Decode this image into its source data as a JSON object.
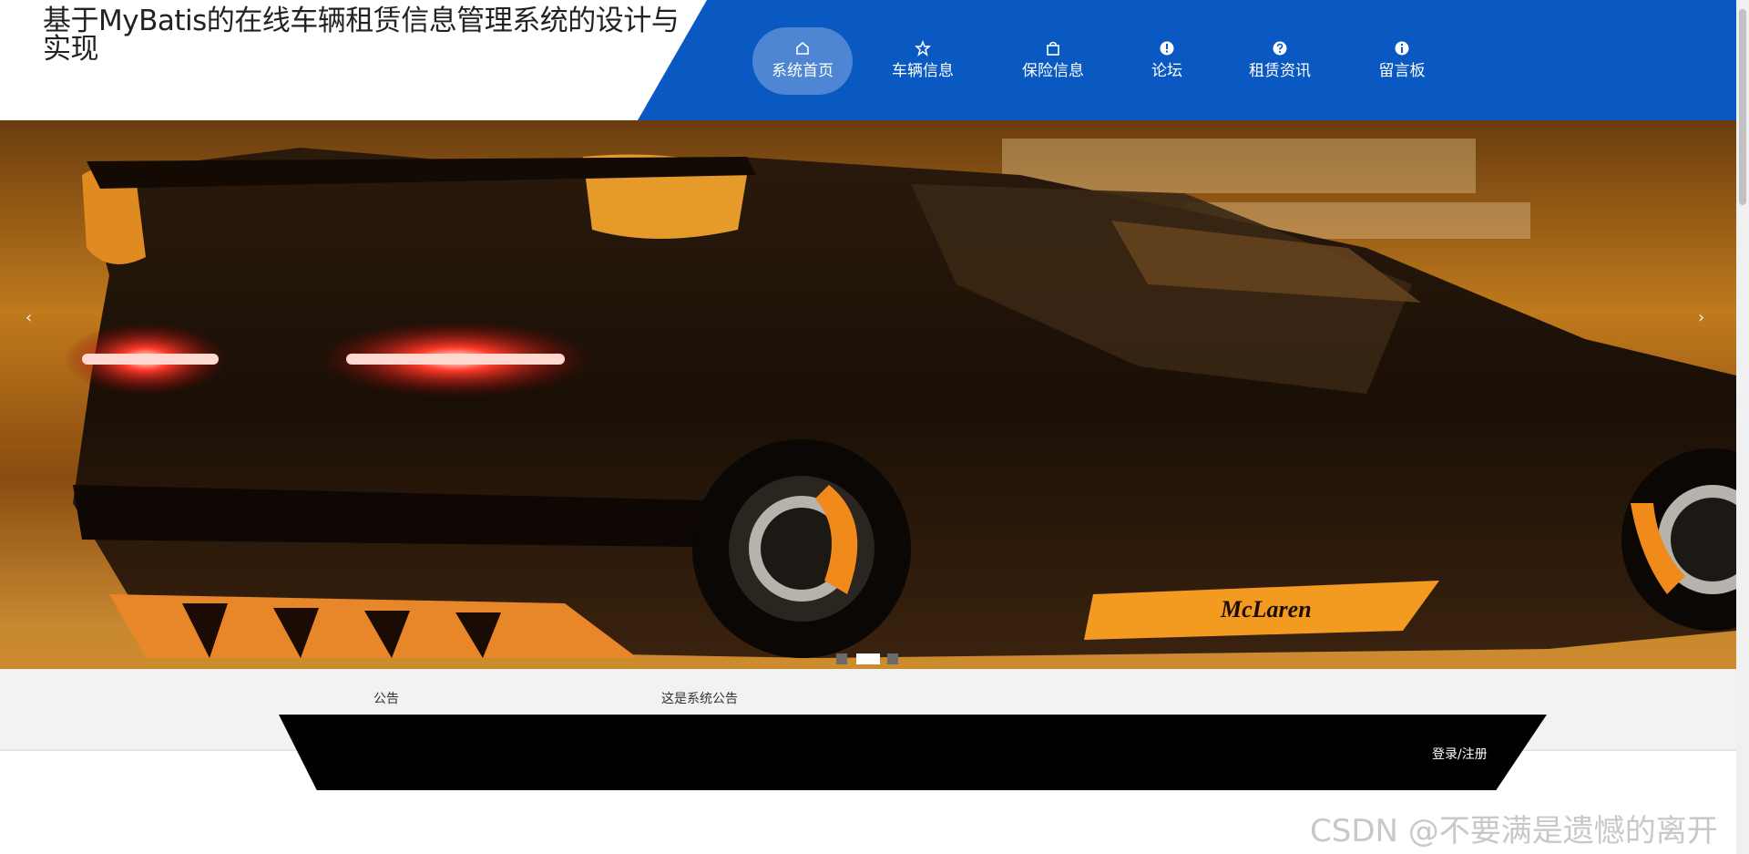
{
  "site": {
    "title": "基于MyBatis的在线车辆租赁信息管理系统的设计与实现"
  },
  "nav": {
    "items": [
      {
        "label": "系统首页",
        "icon": "home-icon",
        "active": true
      },
      {
        "label": "车辆信息",
        "icon": "star-icon",
        "active": false
      },
      {
        "label": "保险信息",
        "icon": "bag-icon",
        "active": false
      },
      {
        "label": "论坛",
        "icon": "info-circle-icon",
        "active": false
      },
      {
        "label": "租赁资讯",
        "icon": "help-circle-icon",
        "active": false
      },
      {
        "label": "留言板",
        "icon": "info-circle-icon",
        "active": false
      }
    ]
  },
  "banner": {
    "image": "supercar-rear-photo",
    "brand_text": "McLaren",
    "prev_arrow": "‹",
    "next_arrow": "›",
    "slides_total": 3,
    "active_slide": 2
  },
  "notice": {
    "label": "公告",
    "text": "这是系统公告"
  },
  "auth": {
    "login_label": "登录/注册"
  },
  "watermark": "CSDN @不要满是遗憾的离开",
  "colors": {
    "nav_blue": "#0a58c2",
    "black_bar": "#000000",
    "notice_bg": "#f2f2f2"
  }
}
